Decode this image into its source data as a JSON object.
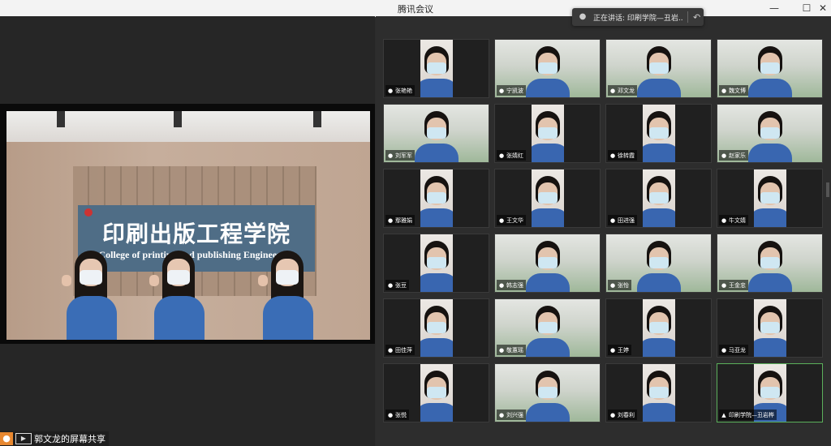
{
  "window": {
    "title": "腾讯会议",
    "minimize_glyph": "—",
    "maximize_glyph": "☐",
    "close_glyph": "✕"
  },
  "toast": {
    "speaking_text": "正在讲话: 印刷学院—丑岩...",
    "back_glyph": "↶"
  },
  "shared_screen": {
    "sign_chinese": "印刷出版工程学院",
    "sign_english": "College of printing and publishing Engineering"
  },
  "share_label": {
    "text": "郭文龙的屏幕共享"
  },
  "participants": [
    {
      "name": "张艳艳",
      "feed": "indoor"
    },
    {
      "name": "宁凯波",
      "feed": "dorm"
    },
    {
      "name": "邓文龙",
      "feed": "dorm"
    },
    {
      "name": "魏文博",
      "feed": "dorm"
    },
    {
      "name": "刘军军",
      "feed": "dorm"
    },
    {
      "name": "张婧红",
      "feed": "indoor"
    },
    {
      "name": "徐转霞",
      "feed": "indoor"
    },
    {
      "name": "赵家乐",
      "feed": "dorm"
    },
    {
      "name": "鄢雅娟",
      "feed": "indoor"
    },
    {
      "name": "王文华",
      "feed": "indoor"
    },
    {
      "name": "田进强",
      "feed": "indoor"
    },
    {
      "name": "牛文婧",
      "feed": "indoor"
    },
    {
      "name": "张豆",
      "feed": "indoor"
    },
    {
      "name": "韩志强",
      "feed": "dorm"
    },
    {
      "name": "张怡",
      "feed": "dorm"
    },
    {
      "name": "王金忠",
      "feed": "dorm"
    },
    {
      "name": "田佳萍",
      "feed": "indoor"
    },
    {
      "name": "敬蕙瑶",
      "feed": "dorm"
    },
    {
      "name": "王婷",
      "feed": "indoor"
    },
    {
      "name": "马亚龙",
      "feed": "indoor"
    },
    {
      "name": "张悦",
      "feed": "indoor"
    },
    {
      "name": "刘兴强",
      "feed": "dorm"
    },
    {
      "name": "刘春利",
      "feed": "indoor"
    },
    {
      "name": "印刷学院—丑岩桦",
      "feed": "indoor",
      "active": true
    }
  ],
  "colors": {
    "active_border": "#5bb05b",
    "uniform_blue": "#3966b0",
    "sign_blue": "#4f6d86"
  }
}
